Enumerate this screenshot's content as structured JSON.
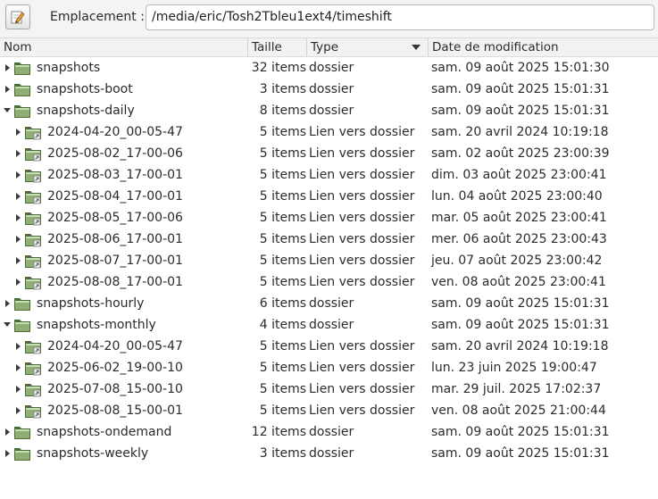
{
  "location": {
    "label": "Emplacement :",
    "path": "/media/eric/Tosh2Tbleu1ext4/timeshift"
  },
  "columns": {
    "name": "Nom",
    "size": "Taille",
    "type": "Type",
    "modified": "Date de modification"
  },
  "rows": [
    {
      "name": "snapshots",
      "size": "32 items",
      "type": "dossier",
      "modified": "sam. 09 août 2025 15:01:30",
      "depth": 0,
      "expanded": false,
      "link": false
    },
    {
      "name": "snapshots-boot",
      "size": "3 items",
      "type": "dossier",
      "modified": "sam. 09 août 2025 15:01:31",
      "depth": 0,
      "expanded": false,
      "link": false
    },
    {
      "name": "snapshots-daily",
      "size": "8 items",
      "type": "dossier",
      "modified": "sam. 09 août 2025 15:01:31",
      "depth": 0,
      "expanded": true,
      "link": false
    },
    {
      "name": "2024-04-20_00-05-47",
      "size": "5 items",
      "type": "Lien vers dossier",
      "modified": "sam. 20 avril 2024 10:19:18",
      "depth": 1,
      "expanded": false,
      "link": true
    },
    {
      "name": "2025-08-02_17-00-06",
      "size": "5 items",
      "type": "Lien vers dossier",
      "modified": "sam. 02 août 2025 23:00:39",
      "depth": 1,
      "expanded": false,
      "link": true
    },
    {
      "name": "2025-08-03_17-00-01",
      "size": "5 items",
      "type": "Lien vers dossier",
      "modified": "dim. 03 août 2025 23:00:41",
      "depth": 1,
      "expanded": false,
      "link": true
    },
    {
      "name": "2025-08-04_17-00-01",
      "size": "5 items",
      "type": "Lien vers dossier",
      "modified": "lun. 04 août 2025 23:00:40",
      "depth": 1,
      "expanded": false,
      "link": true
    },
    {
      "name": "2025-08-05_17-00-06",
      "size": "5 items",
      "type": "Lien vers dossier",
      "modified": "mar. 05 août 2025 23:00:41",
      "depth": 1,
      "expanded": false,
      "link": true
    },
    {
      "name": "2025-08-06_17-00-01",
      "size": "5 items",
      "type": "Lien vers dossier",
      "modified": "mer. 06 août 2025 23:00:43",
      "depth": 1,
      "expanded": false,
      "link": true
    },
    {
      "name": "2025-08-07_17-00-01",
      "size": "5 items",
      "type": "Lien vers dossier",
      "modified": "jeu. 07 août 2025 23:00:42",
      "depth": 1,
      "expanded": false,
      "link": true
    },
    {
      "name": "2025-08-08_17-00-01",
      "size": "5 items",
      "type": "Lien vers dossier",
      "modified": "ven. 08 août 2025 23:00:41",
      "depth": 1,
      "expanded": false,
      "link": true
    },
    {
      "name": "snapshots-hourly",
      "size": "6 items",
      "type": "dossier",
      "modified": "sam. 09 août 2025 15:01:31",
      "depth": 0,
      "expanded": false,
      "link": false
    },
    {
      "name": "snapshots-monthly",
      "size": "4 items",
      "type": "dossier",
      "modified": "sam. 09 août 2025 15:01:31",
      "depth": 0,
      "expanded": true,
      "link": false
    },
    {
      "name": "2024-04-20_00-05-47",
      "size": "5 items",
      "type": "Lien vers dossier",
      "modified": "sam. 20 avril 2024 10:19:18",
      "depth": 1,
      "expanded": false,
      "link": true
    },
    {
      "name": "2025-06-02_19-00-10",
      "size": "5 items",
      "type": "Lien vers dossier",
      "modified": "lun. 23 juin 2025 19:00:47",
      "depth": 1,
      "expanded": false,
      "link": true
    },
    {
      "name": "2025-07-08_15-00-10",
      "size": "5 items",
      "type": "Lien vers dossier",
      "modified": "mar. 29 juil. 2025 17:02:37",
      "depth": 1,
      "expanded": false,
      "link": true
    },
    {
      "name": "2025-08-08_15-00-01",
      "size": "5 items",
      "type": "Lien vers dossier",
      "modified": "ven. 08 août 2025 21:00:44",
      "depth": 1,
      "expanded": false,
      "link": true
    },
    {
      "name": "snapshots-ondemand",
      "size": "12 items",
      "type": "dossier",
      "modified": "sam. 09 août 2025 15:01:31",
      "depth": 0,
      "expanded": false,
      "link": false
    },
    {
      "name": "snapshots-weekly",
      "size": "3 items",
      "type": "dossier",
      "modified": "sam. 09 août 2025 15:01:31",
      "depth": 0,
      "expanded": false,
      "link": false
    }
  ],
  "icons": {
    "edit": "edit-pencil-icon",
    "folder": "folder-icon",
    "folder_link": "folder-link-icon",
    "sort": "sort-descending-icon"
  },
  "colors": {
    "folder_body": "#8fae74",
    "folder_dark": "#4e6b3c",
    "folder_light": "#c7ddb3"
  }
}
